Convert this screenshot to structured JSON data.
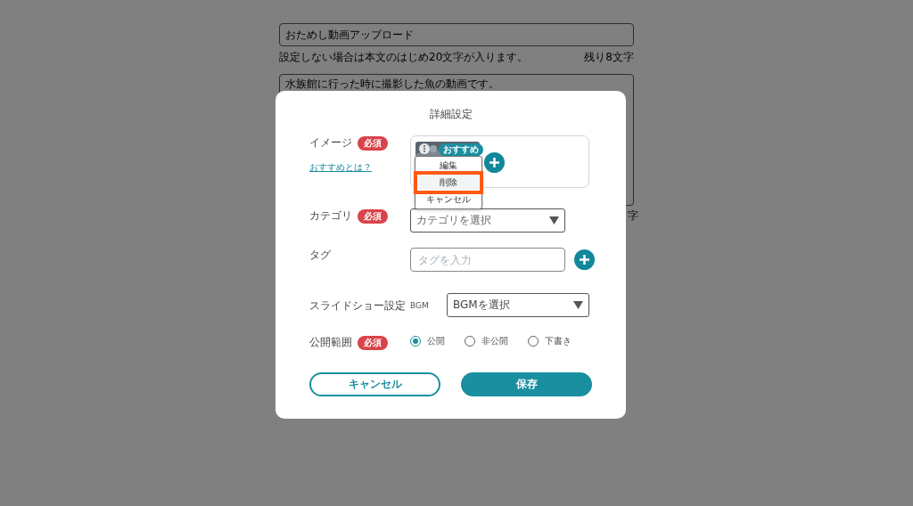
{
  "page": {
    "title_field": {
      "value": "おためし動画アップロード"
    },
    "title_hint": "設定しない場合は本文のはじめ20文字が入ります。",
    "title_remaining": "残り8文字",
    "body_field": {
      "value": "水族館に行った時に撮影した魚の動画です。"
    },
    "body_counter": "字"
  },
  "dialog": {
    "title": "詳細設定",
    "image": {
      "label": "イメージ",
      "required_badge": "必須",
      "help_link": "おすすめとは？",
      "thumbnail_badge": "おすすめ",
      "menu_items": [
        {
          "label": "編集",
          "selected": false
        },
        {
          "label": "削除",
          "selected": true
        },
        {
          "label": "キャンセル",
          "selected": false
        }
      ]
    },
    "category": {
      "label": "カテゴリ",
      "required_badge": "必須",
      "placeholder": "カテゴリを選択"
    },
    "tag": {
      "label": "タグ",
      "placeholder": "タグを入力"
    },
    "slideshow": {
      "label": "スライドショー設定",
      "sublabel": "BGM",
      "value": "BGMを選択"
    },
    "visibility": {
      "label": "公開範囲",
      "required_badge": "必須",
      "options": [
        {
          "label": "公開",
          "selected": true
        },
        {
          "label": "非公開",
          "selected": false
        },
        {
          "label": "下書き",
          "selected": false
        }
      ]
    },
    "buttons": [
      {
        "label": "キャンセル",
        "kind": "secondary"
      },
      {
        "label": "保存",
        "kind": "primary"
      }
    ]
  }
}
